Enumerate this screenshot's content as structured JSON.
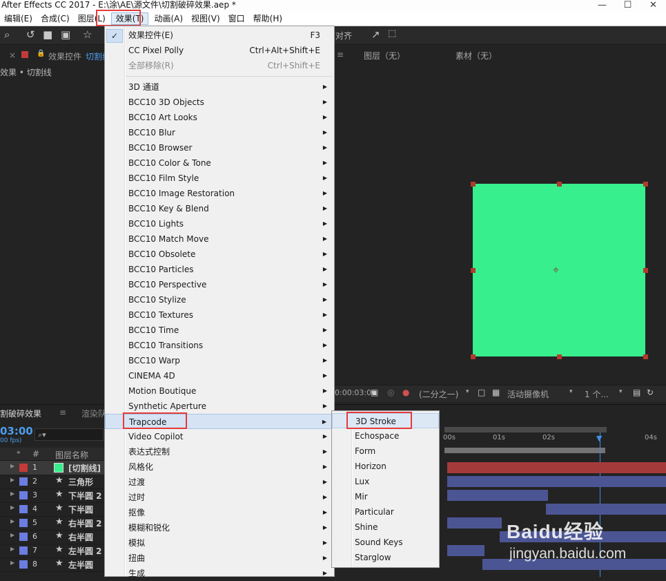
{
  "window": {
    "title": "After Effects CC 2017 - E:\\涂\\AE\\源文件\\切割破碎效果.aep *",
    "controls": [
      "—",
      "☐",
      "✕"
    ]
  },
  "menubar": [
    {
      "label": "编辑(E)"
    },
    {
      "label": "合成(C)"
    },
    {
      "label": "图层(L)"
    },
    {
      "label": "效果(T)",
      "active": true
    },
    {
      "label": "动画(A)"
    },
    {
      "label": "视图(V)"
    },
    {
      "label": "窗口"
    },
    {
      "label": "帮助(H)"
    }
  ],
  "toolbar": {
    "align_label": "对齐"
  },
  "left_panel": {
    "tab_label": "效果控件",
    "tab_layer": "切割线",
    "breadcrumb": "效果 • 切割线"
  },
  "viewer": {
    "layer_label": "图层（无）",
    "footage_label": "素材（无）",
    "timecode": "0:00:03:00",
    "resolution": "(二分之一)",
    "camera": "活动摄像机",
    "views": "1 个..."
  },
  "effects_menu": [
    {
      "label": "效果控件(E)",
      "shortcut": "F3",
      "checked": true
    },
    {
      "label": "CC Pixel Polly",
      "shortcut": "Ctrl+Alt+Shift+E"
    },
    {
      "label": "全部移除(R)",
      "shortcut": "Ctrl+Shift+E",
      "disabled": true
    },
    {
      "label": "3D 通道",
      "submenu": true
    },
    {
      "label": "BCC10 3D Objects",
      "submenu": true
    },
    {
      "label": "BCC10 Art Looks",
      "submenu": true
    },
    {
      "label": "BCC10 Blur",
      "submenu": true
    },
    {
      "label": "BCC10 Browser",
      "submenu": true
    },
    {
      "label": "BCC10 Color & Tone",
      "submenu": true
    },
    {
      "label": "BCC10 Film Style",
      "submenu": true
    },
    {
      "label": "BCC10 Image Restoration",
      "submenu": true
    },
    {
      "label": "BCC10 Key & Blend",
      "submenu": true
    },
    {
      "label": "BCC10 Lights",
      "submenu": true
    },
    {
      "label": "BCC10 Match Move",
      "submenu": true
    },
    {
      "label": "BCC10 Obsolete",
      "submenu": true
    },
    {
      "label": "BCC10 Particles",
      "submenu": true
    },
    {
      "label": "BCC10 Perspective",
      "submenu": true
    },
    {
      "label": "BCC10 Stylize",
      "submenu": true
    },
    {
      "label": "BCC10 Textures",
      "submenu": true
    },
    {
      "label": "BCC10 Time",
      "submenu": true
    },
    {
      "label": "BCC10 Transitions",
      "submenu": true
    },
    {
      "label": "BCC10 Warp",
      "submenu": true
    },
    {
      "label": "CINEMA 4D",
      "submenu": true
    },
    {
      "label": "Motion Boutique",
      "submenu": true
    },
    {
      "label": "Synthetic Aperture",
      "submenu": true
    },
    {
      "label": "Trapcode",
      "submenu": true,
      "highlighted": true
    },
    {
      "label": "Video Copilot",
      "submenu": true
    },
    {
      "label": "表达式控制",
      "submenu": true
    },
    {
      "label": "风格化",
      "submenu": true
    },
    {
      "label": "过渡",
      "submenu": true
    },
    {
      "label": "过时",
      "submenu": true
    },
    {
      "label": "抠像",
      "submenu": true
    },
    {
      "label": "模糊和锐化",
      "submenu": true
    },
    {
      "label": "模拟",
      "submenu": true
    },
    {
      "label": "扭曲",
      "submenu": true
    },
    {
      "label": "生成",
      "submenu": true
    }
  ],
  "trapcode_submenu": [
    {
      "label": "3D Stroke",
      "highlighted": true
    },
    {
      "label": "Echospace"
    },
    {
      "label": "Form"
    },
    {
      "label": "Horizon"
    },
    {
      "label": "Lux"
    },
    {
      "label": "Mir"
    },
    {
      "label": "Particular"
    },
    {
      "label": "Shine"
    },
    {
      "label": "Sound Keys"
    },
    {
      "label": "Starglow"
    }
  ],
  "timeline": {
    "comp_tab": "割破碎效果",
    "render_tab": "渲染队",
    "timecode": "03:00",
    "fps": "00 fps)",
    "col_hash": "#",
    "col_name": "图层名称",
    "ruler": [
      "00s",
      "01s",
      "02s",
      "04s"
    ],
    "layers": [
      {
        "num": "1",
        "name": "[切割线]",
        "color": "#c23a3a",
        "solid": true,
        "bar_start": 0.0,
        "bar_end": 1.0
      },
      {
        "num": "2",
        "name": "三角形",
        "color": "#6b7de0",
        "bar_start": 0.0,
        "bar_end": 1.0
      },
      {
        "num": "3",
        "name": "下半圆 2",
        "color": "#6b7de0",
        "bar_start": 0.0,
        "bar_end": 0.46
      },
      {
        "num": "4",
        "name": "下半圆",
        "color": "#6b7de0",
        "bar_start": 0.45,
        "bar_end": 1.0
      },
      {
        "num": "5",
        "name": "右半圆 2",
        "color": "#6b7de0",
        "bar_start": 0.0,
        "bar_end": 0.25
      },
      {
        "num": "6",
        "name": "右半圆",
        "color": "#6b7de0",
        "bar_start": 0.24,
        "bar_end": 1.0
      },
      {
        "num": "7",
        "name": "左半圆 2",
        "color": "#6b7de0",
        "bar_start": 0.0,
        "bar_end": 0.17
      },
      {
        "num": "8",
        "name": "左半圆",
        "color": "#6b7de0",
        "bar_start": 0.16,
        "bar_end": 1.0
      }
    ]
  },
  "watermark": {
    "brand": "Baidu经验",
    "url": "jingyan.baidu.com"
  }
}
